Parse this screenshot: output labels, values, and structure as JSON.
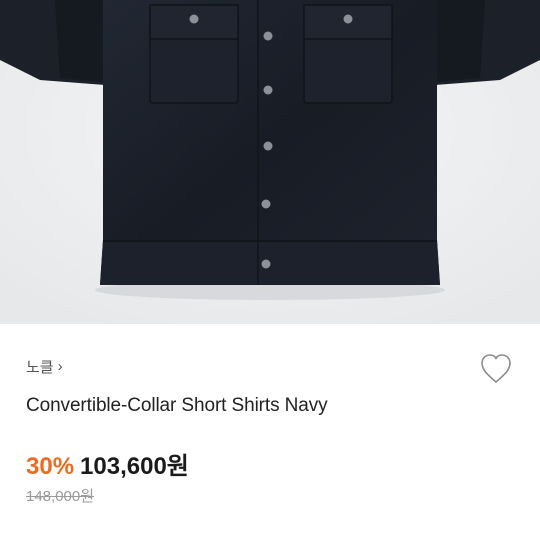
{
  "product": {
    "image_alt": "navy short-sleeve shirt",
    "brand": "노클",
    "brand_chevron": "›",
    "title": "Convertible-Collar Short Shirts Navy",
    "discount": "30%",
    "price": "103,600원",
    "original_price": "148,000원",
    "like_icon": "heart-outline-icon"
  },
  "colors": {
    "discount": "#f06a1e",
    "shirt": "#1a1f28",
    "photo_bg": "#eef0f1"
  }
}
